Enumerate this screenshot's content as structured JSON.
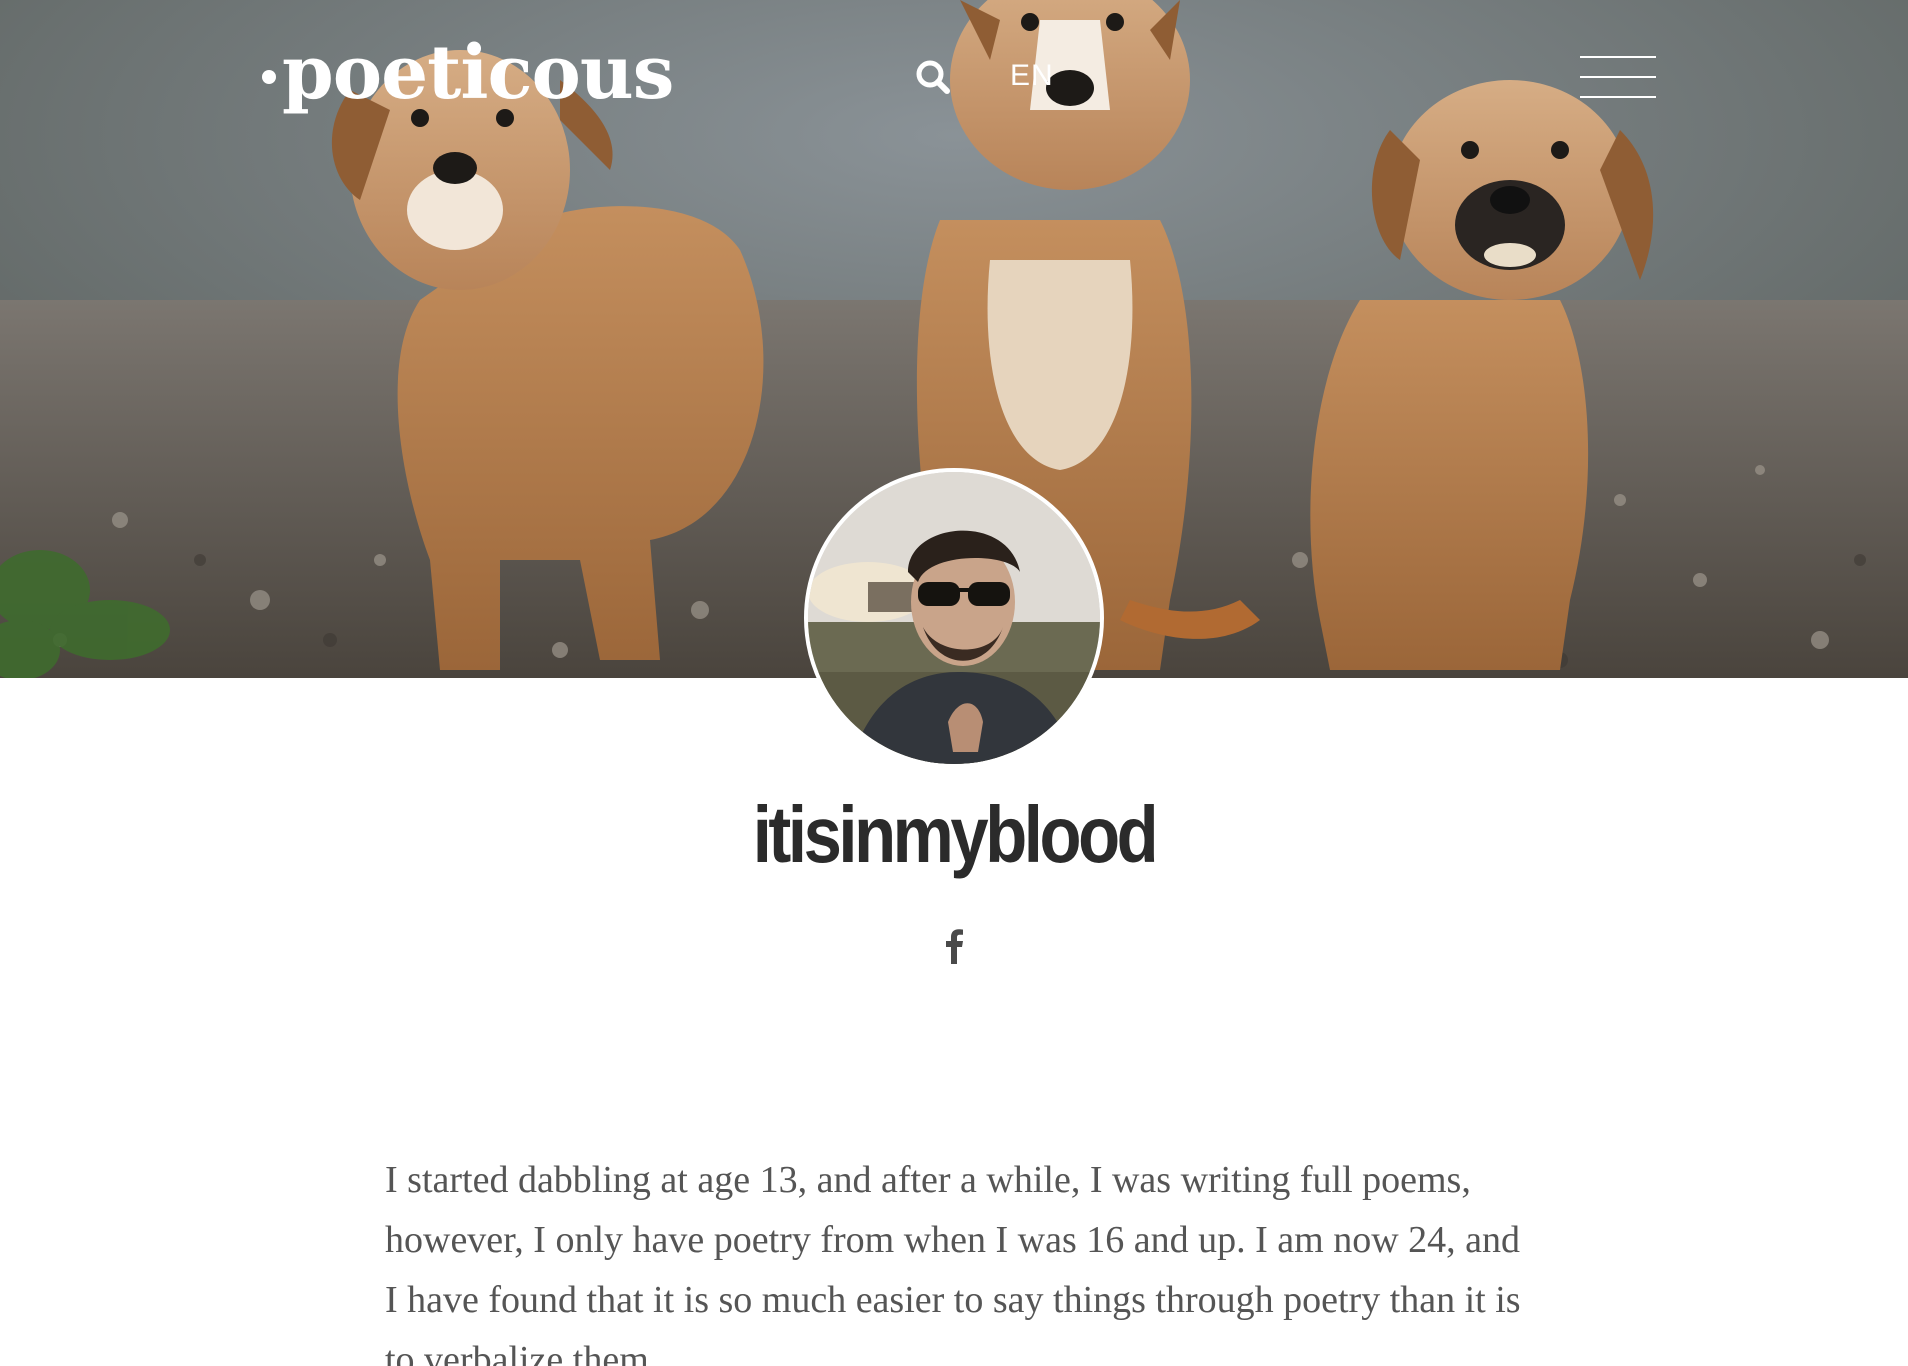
{
  "header": {
    "logo_text": "poeticous",
    "language_label": "EN"
  },
  "icons": {
    "search": "search-icon",
    "menu": "hamburger-menu-icon",
    "social": "facebook-icon"
  },
  "hero": {
    "image_subject": "three puppies on gravel"
  },
  "profile": {
    "username": "itisinmyblood",
    "bio": "I started dabbling at age 13, and after a while, I was writing full poems, however, I only have poetry from when I was 16 and up. I am now 24, and I have found that it is so much easier to say things through poetry than it is to verbalize them."
  },
  "colors": {
    "heading": "#2b2b2b",
    "body_text": "#555555",
    "header_text": "#ffffff"
  }
}
